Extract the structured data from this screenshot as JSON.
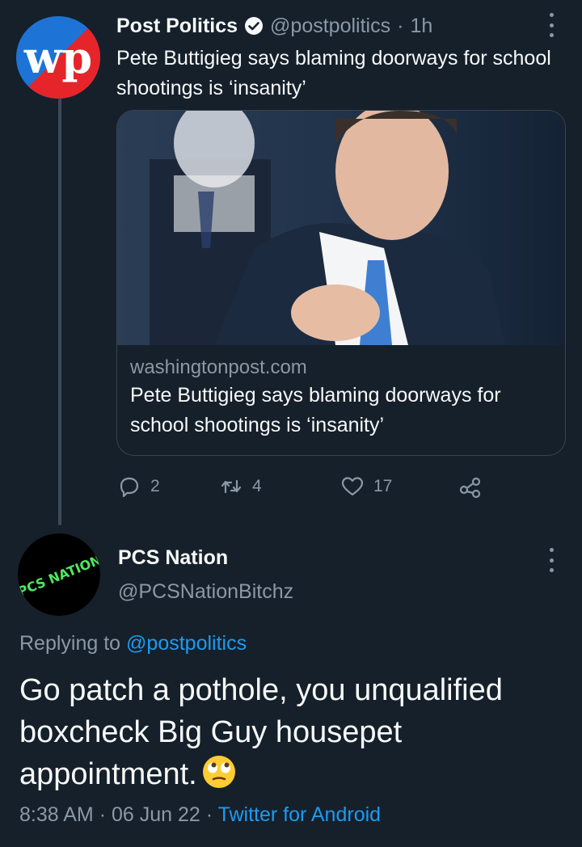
{
  "parent_tweet": {
    "author_name": "Post Politics",
    "handle": "@postpolitics",
    "separator": "·",
    "time": "1h",
    "text": "Pete Buttigieg says blaming doorways for school shootings is ‘insanity’",
    "logo_text": "wp",
    "card": {
      "domain": "washingtonpost.com",
      "title": "Pete Buttigieg says blaming doorways for school shootings is ‘insanity’"
    },
    "actions": {
      "replies": "2",
      "retweets": "4",
      "likes": "17"
    }
  },
  "reply_tweet": {
    "author_name": "PCS Nation",
    "handle": "@PCSNationBitchz",
    "avatar_text": "PCS NATION",
    "replying_prefix": "Replying to",
    "replying_to": "@postpolitics",
    "text": "Go patch a pothole, you unqualified boxcheck Big Guy housepet appointment.",
    "emoji": "eye-roll-emoji",
    "time": "8:38 AM",
    "separator1": "·",
    "date": "06 Jun 22",
    "separator2": "·",
    "source": "Twitter for Android"
  },
  "colors": {
    "background": "#15202b",
    "accent": "#1d9bf0",
    "secondary_text": "#8b98a5",
    "border": "#38444d"
  }
}
